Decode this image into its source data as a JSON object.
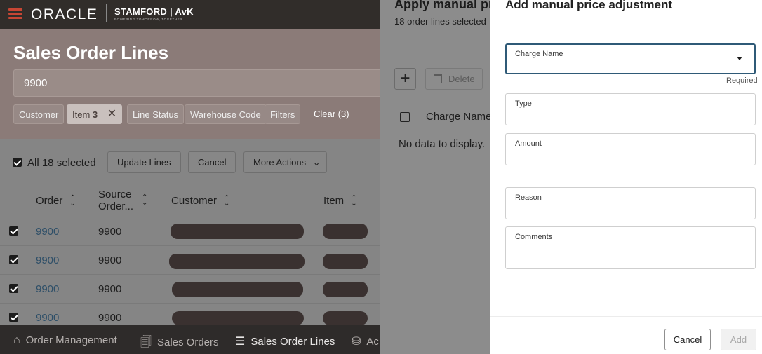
{
  "app": {
    "oracle_logo": "ORACLE",
    "brand": "STAMFORD | AvK",
    "brand_sub": "POWERING TOMORROW, TOGETHER"
  },
  "page": {
    "title": "Sales Order Lines",
    "search_value": "9900",
    "filters": [
      {
        "label": "Customer"
      },
      {
        "label": "Item",
        "value": "3",
        "active": true
      },
      {
        "label": "Line Status"
      },
      {
        "label": "Warehouse Code"
      },
      {
        "label": "Filters"
      }
    ],
    "clear_label": "Clear (3)"
  },
  "toolbar": {
    "select_all_label": "All 18 selected",
    "update_lines": "Update Lines",
    "cancel": "Cancel",
    "more_actions": "More Actions"
  },
  "table": {
    "columns": [
      "Order",
      "Source Order...",
      "Customer",
      "Item"
    ],
    "rows": [
      {
        "order": "9900",
        "source": "9900"
      },
      {
        "order": "9900",
        "source": "9900"
      },
      {
        "order": "9900",
        "source": "9900"
      },
      {
        "order": "9900",
        "source": "9900"
      }
    ]
  },
  "footer_nav": [
    {
      "icon": "home-icon",
      "label": "Order Management"
    },
    {
      "icon": "document-icon",
      "label": "Sales Orders"
    },
    {
      "icon": "list-icon",
      "label": "Sales Order Lines",
      "active": true
    },
    {
      "icon": "database-icon",
      "label": "Ac"
    }
  ],
  "middle_drawer": {
    "title": "Apply manual pri",
    "subtitle": "18 order lines selected",
    "delete_label": "Delete",
    "column": "Charge Name",
    "no_data": "No data to display."
  },
  "dialog": {
    "title": "Add manual price adjustment",
    "fields": {
      "charge_name": "Charge Name",
      "required": "Required",
      "type": "Type",
      "amount": "Amount",
      "reason": "Reason",
      "comments": "Comments"
    },
    "cancel": "Cancel",
    "add": "Add"
  },
  "colors": {
    "oracle_red": "#c74634",
    "focus_border": "#2f5a77",
    "link": "#2e4f68"
  }
}
